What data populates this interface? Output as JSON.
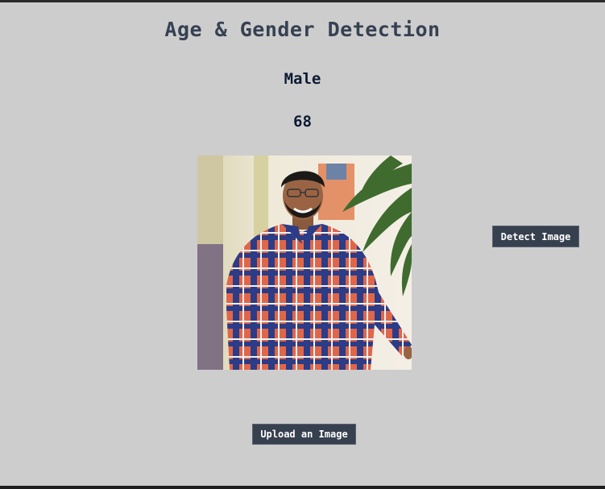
{
  "app": {
    "title": "Age & Gender Detection"
  },
  "result": {
    "gender": "Male",
    "age": "68"
  },
  "buttons": {
    "detect_label": "Detect Image",
    "upload_label": "Upload an Image"
  },
  "colors": {
    "background": "#cdcdcd",
    "title": "#364152",
    "result_text": "#0c1a33",
    "button_bg": "#36404f",
    "button_text": "#ffffff"
  }
}
